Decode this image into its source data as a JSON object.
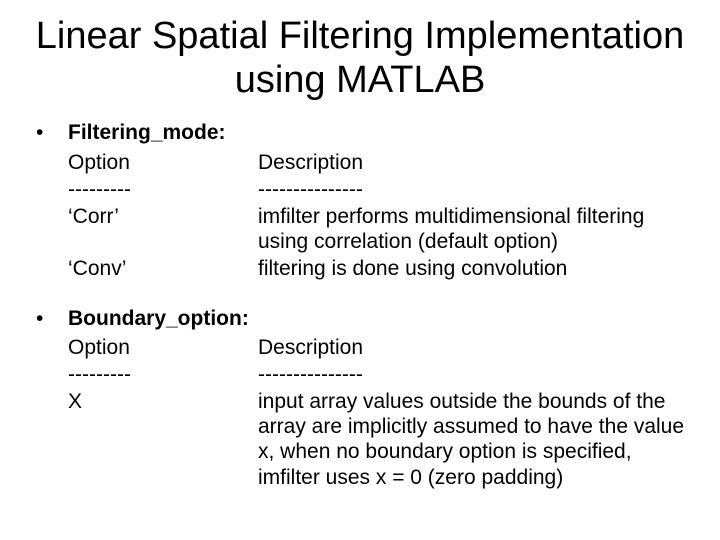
{
  "title": "Linear Spatial Filtering Implementation using MATLAB",
  "sections": [
    {
      "heading": "Filtering_mode:",
      "opt_header": "Option",
      "desc_header": "Description",
      "opt_dash": "---------",
      "desc_dash": "---------------",
      "rows": [
        {
          "opt": "‘Corr’",
          "desc": "imfilter performs multidimensional filtering using correlation (default option)"
        },
        {
          "opt": "‘Conv’",
          "desc": "filtering is done using convolution"
        }
      ]
    },
    {
      "heading": "Boundary_option:",
      "opt_header": "Option",
      "desc_header": "Description",
      "opt_dash": "---------",
      "desc_dash": "---------------",
      "rows": [
        {
          "opt": "X",
          "desc": "input array values outside the bounds of the array are implicitly assumed to have the value x, when no boundary option is specified, imfilter uses x = 0 (zero padding)"
        }
      ]
    }
  ]
}
